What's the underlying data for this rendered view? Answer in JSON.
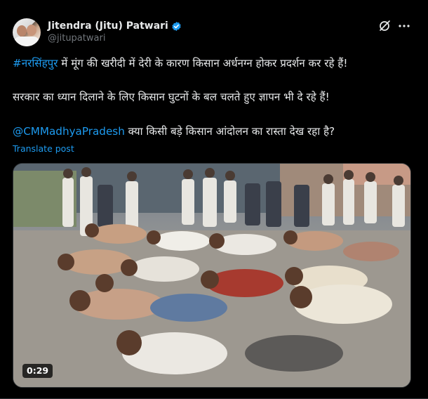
{
  "author": {
    "display_name": "Jitendra (Jitu) Patwari",
    "handle": "@jitupatwari",
    "verified_icon": "verified-badge-icon"
  },
  "post": {
    "line1": {
      "hashtag": "#नरसिंहपुर",
      "text": " में मूंग की खरीदी में देरी के कारण किसान अर्धनग्न होकर प्रदर्शन कर रहे हैं!"
    },
    "line2": "सरकार का ध्यान दिलाने के लिए किसान घुटनों के बल चलते हुए ज्ञापन भी दे रहे हैं!",
    "line3": {
      "mention": "@CMMadhyaPradesh",
      "text": " क्या किसी बड़े किसान आंदोलन का रास्ता देख रहा है?"
    },
    "translate_label": "Translate post"
  },
  "media": {
    "type": "video",
    "duration": "0:29"
  },
  "colors": {
    "background": "#000000",
    "text": "#e7e9ea",
    "secondary_text": "#71767b",
    "link": "#1d9bf0"
  }
}
